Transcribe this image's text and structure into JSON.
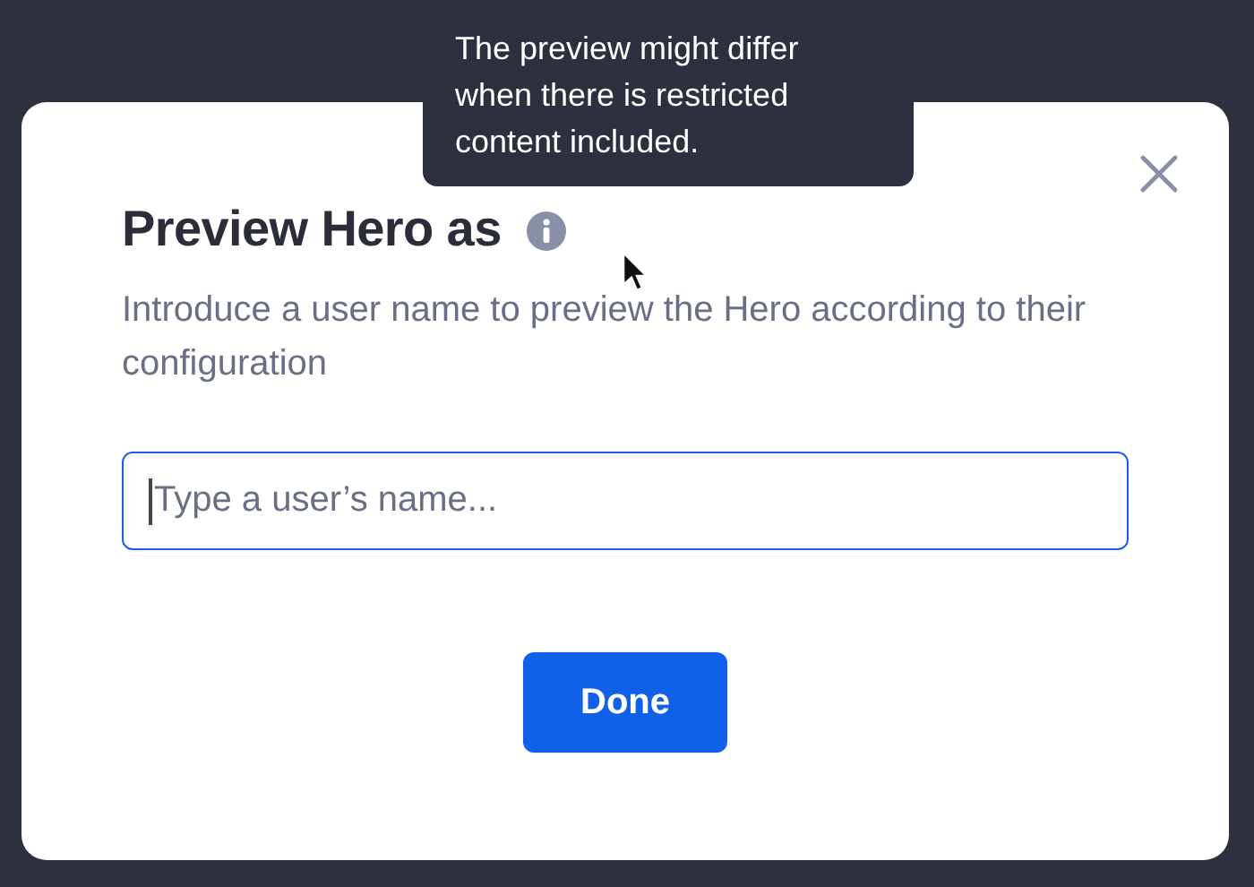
{
  "tooltip": {
    "text": "The preview might differ when there is restricted content included."
  },
  "dialog": {
    "title": "Preview Hero as",
    "description": "Introduce a user name to preview the Hero according to their configuration",
    "field": {
      "placeholder": "Type a user’s name...",
      "focused": true
    },
    "buttons": [
      {
        "label": "Done",
        "kind": "primary"
      }
    ]
  }
}
